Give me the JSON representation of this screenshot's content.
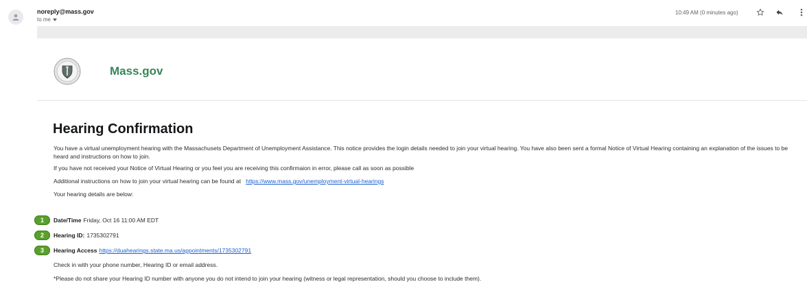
{
  "header": {
    "sender": "noreply@mass.gov",
    "recipient": "to me",
    "timestamp": "10:49 AM (0 minutes ago)",
    "icons": [
      "avatar-icon",
      "star-icon",
      "reply-icon",
      "more-vert-icon"
    ]
  },
  "brand": {
    "name": "Mass.gov",
    "seal_icon": "massachusetts-seal-icon",
    "color": "#388557"
  },
  "email": {
    "title": "Hearing Confirmation",
    "para1": "You have a virtual unemployment hearing with the Massachusets Department of Unemployment Assistance. This notice provides the login details needed to join your virtual hearing. You have also been sent a formal Notice of Virtual Hearing containing an explanation of the issues to be heard and instructions on how to join.",
    "para2": "If you have not received your Notice of Virtual Hearing or you feel you are receiving this confirmaion in error, please call as soon as possible",
    "para3_prefix": "Additional instructions on how to join your virtual hearing can be found at",
    "para3_link": "https://www.mass.gov/unemployment-virtual-hearings",
    "para4": "Your hearing details are below:",
    "details": [
      {
        "num": "1",
        "label": "Date/Time",
        "value": "Friday, Oct 16 11:00 AM EDT"
      },
      {
        "num": "2",
        "label": "Hearing ID:",
        "value": "1735302791"
      },
      {
        "num": "3",
        "label": "Hearing Access",
        "value": "https://duahearings.state.ma.us/appointments/1735302791"
      }
    ],
    "para5": "Check in with your phone number, Hearing ID or email address.",
    "para6": "*Please do not share your Hearing ID number with anyone you do not intend to join your hearing (witness or legal representation, should you choose to include them)."
  },
  "colors": {
    "badge": "#5aa02c",
    "link": "#1a5fd0"
  }
}
